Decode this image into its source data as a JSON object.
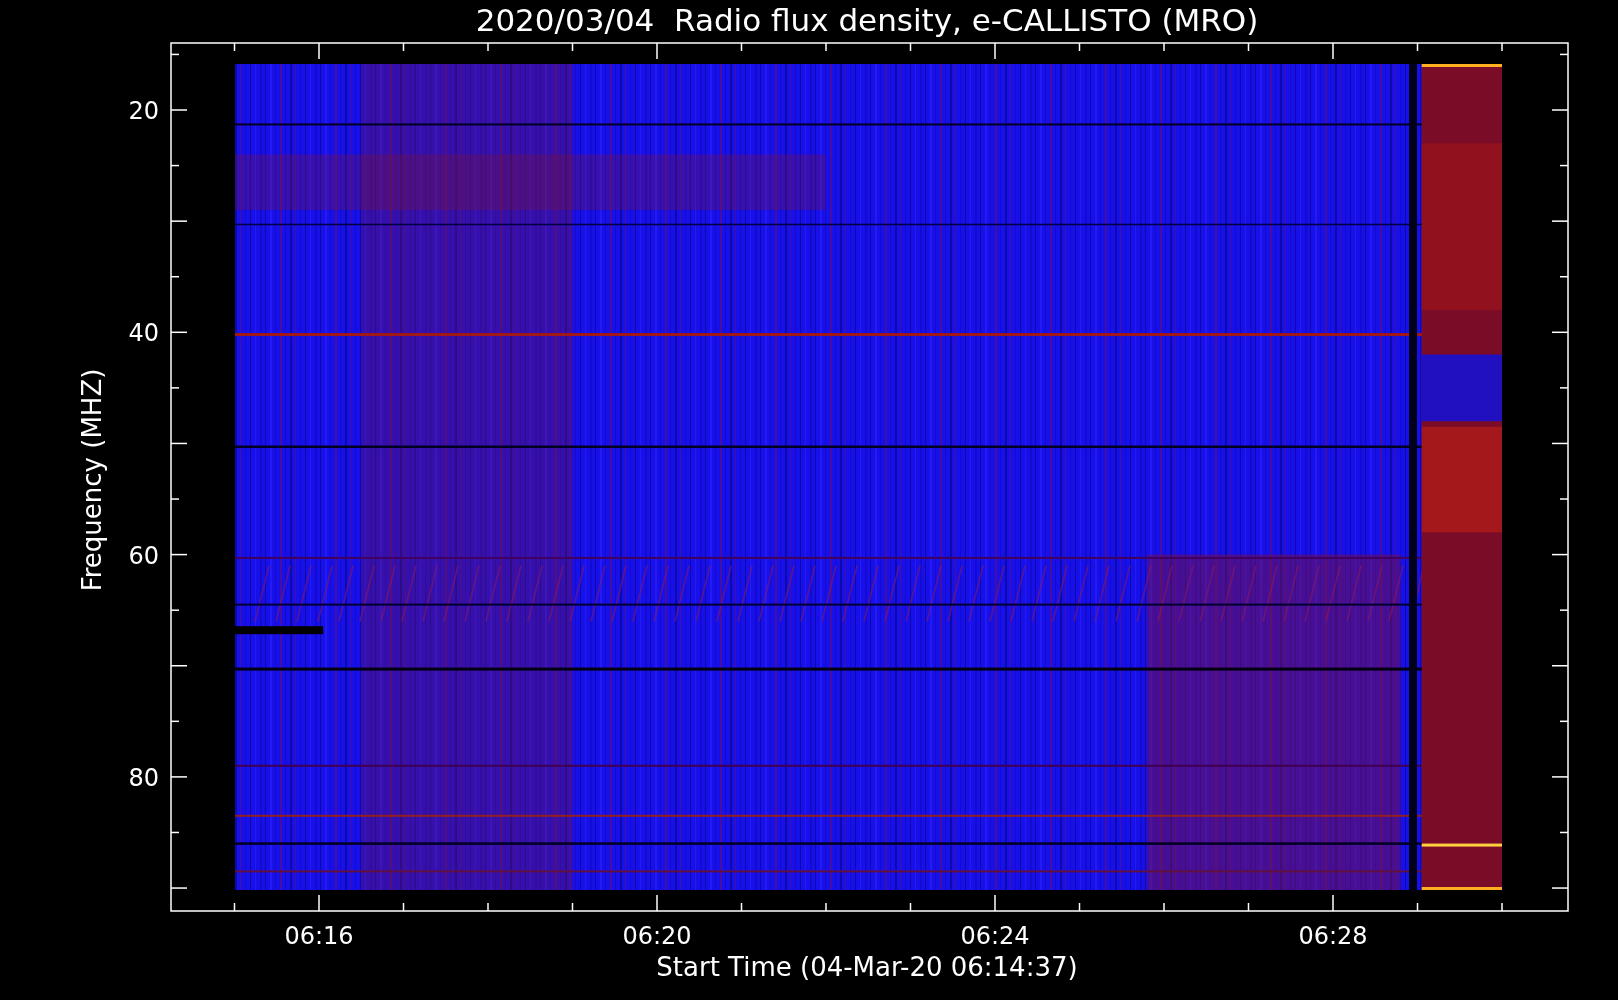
{
  "plot": {
    "title": "2020/03/04  Radio flux density, e-CALLISTO (MRO)",
    "xlabel": "Start Time (04-Mar-20 06:14:37)",
    "ylabel": "Frequency (MHZ)",
    "xticks": [
      "06:16",
      "06:20",
      "06:24",
      "06:28"
    ],
    "yticks": [
      "20",
      "40",
      "60",
      "80"
    ]
  }
}
